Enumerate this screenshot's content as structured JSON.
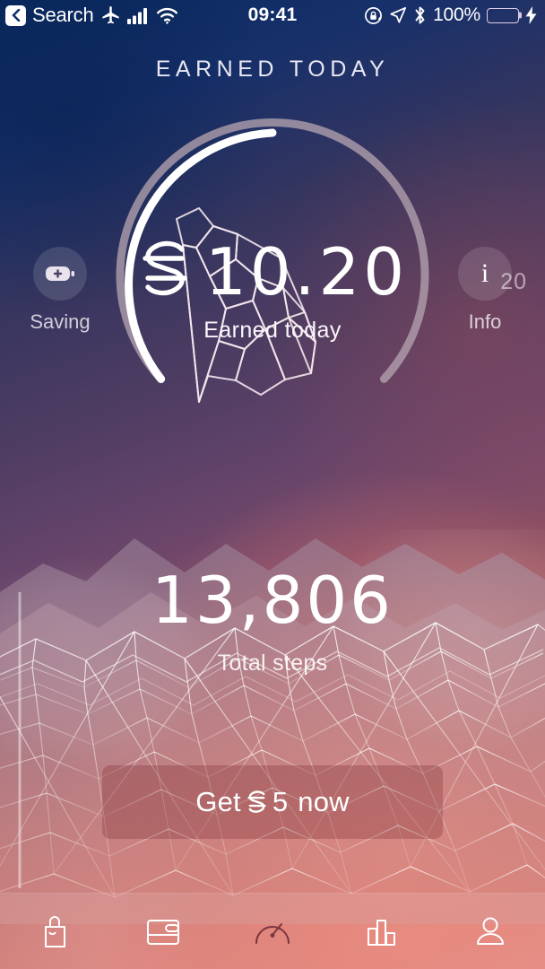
{
  "status_bar": {
    "back_label": "Search",
    "back_icon": "chevron-left-icon",
    "airplane_icon": "airplane-mode-icon",
    "cellular_icon": "cellular-signal-icon",
    "wifi_icon": "wifi-icon",
    "time": "09:41",
    "rotation_lock_icon": "rotation-lock-icon",
    "location_icon": "location-arrow-icon",
    "bluetooth_icon": "bluetooth-icon",
    "battery_percent": "100%",
    "battery_icon": "battery-full-icon",
    "charging_icon": "lightning-bolt-icon",
    "battery_color": "#3ddc56"
  },
  "header": {
    "title": "EARNED  TODAY"
  },
  "gauge": {
    "value": "10.20",
    "currency_symbol": "sweatcoin-symbol",
    "caption": "Earned today",
    "max_label": "20",
    "max_value": 20,
    "current_value": 10.2,
    "progress_percent": 51,
    "track_color": "#b7a6b4",
    "progress_color": "#ffffff",
    "polyhedron_icon": "dodecahedron-wireframe-icon"
  },
  "actions": {
    "left": {
      "label": "Saving",
      "icon": "battery-plus-icon"
    },
    "right": {
      "label": "Info",
      "icon": "info-icon",
      "glyph": "i"
    }
  },
  "steps": {
    "value": "13,806",
    "label": "Total steps"
  },
  "cta": {
    "prefix": "Get",
    "symbol": "sweatcoin-symbol",
    "amount": "5",
    "suffix": "now",
    "full_label": "Get 5 now"
  },
  "tabbar": {
    "items": [
      {
        "name": "shop",
        "icon": "shopping-bag-icon",
        "active": false
      },
      {
        "name": "wallet",
        "icon": "wallet-icon",
        "active": false
      },
      {
        "name": "dashboard",
        "icon": "speedometer-icon",
        "active": true
      },
      {
        "name": "stats",
        "icon": "bar-chart-icon",
        "active": false
      },
      {
        "name": "profile",
        "icon": "person-icon",
        "active": false
      }
    ],
    "active_color": "#7a3540",
    "inactive_color": "#ffffff"
  }
}
